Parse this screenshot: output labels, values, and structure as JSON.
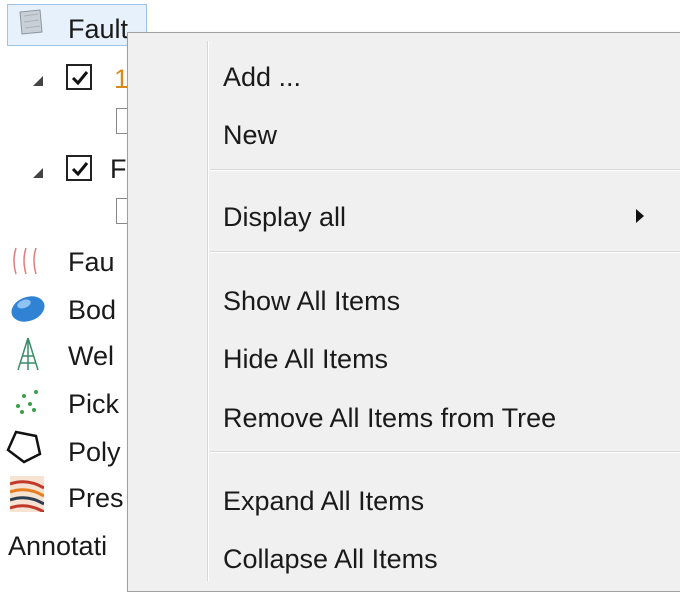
{
  "tree": {
    "items": [
      {
        "label": "Fault",
        "selected": true
      },
      {
        "label": "1"
      },
      {
        "label": "F"
      },
      {
        "label": "Fau"
      },
      {
        "label": "Bod"
      },
      {
        "label": "Wel"
      },
      {
        "label": "Pick"
      },
      {
        "label": "Poly"
      },
      {
        "label": "Pres"
      },
      {
        "label": "Annotati"
      }
    ]
  },
  "menu": {
    "groups": [
      [
        {
          "label": "Add ..."
        },
        {
          "label": "New"
        }
      ],
      [
        {
          "label": "Display all",
          "submenu": true
        }
      ],
      [
        {
          "label": "Show All Items"
        },
        {
          "label": "Hide All Items"
        },
        {
          "label": "Remove All Items from Tree"
        }
      ],
      [
        {
          "label": "Expand All Items"
        },
        {
          "label": "Collapse All Items"
        }
      ]
    ]
  },
  "colors": {
    "selection_bg": "#e6f1fb",
    "selection_border": "#9cc4ea",
    "menu_bg": "#f0f0f0",
    "orange_item": "#d98a1a"
  }
}
